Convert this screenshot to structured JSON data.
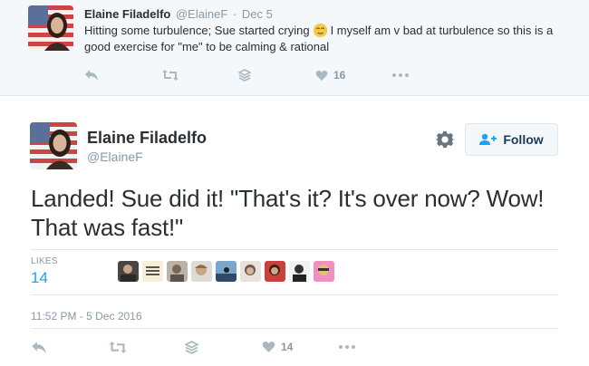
{
  "parent_tweet": {
    "name": "Elaine Filadelfo",
    "handle": "@ElaineF",
    "separator": "·",
    "date": "Dec 5",
    "text_before_emoji": "Hitting some turbulence; Sue started crying",
    "text_after_emoji": "I myself am v bad at turbulence so this is a good exercise for \"me\" to be calming & rational",
    "like_count": "16",
    "icons": [
      "reply-icon",
      "retweet-icon",
      "stack-icon",
      "heart-icon",
      "more-icon"
    ]
  },
  "main_tweet": {
    "name": "Elaine Filadelfo",
    "handle": "@ElaineF",
    "follow_label": "Follow",
    "text": "Landed! Sue did it! \"That's it? It's over now? Wow! That was fast!\"",
    "likes_label": "LIKES",
    "likes_count": "14",
    "timestamp": "11:52 PM - 5 Dec 2016",
    "like_count": "14",
    "liker_count_shown": 9,
    "icons": [
      "reply-icon",
      "retweet-icon",
      "stack-icon",
      "heart-icon",
      "more-icon"
    ]
  },
  "colors": {
    "accent": "#1da1f2",
    "action_icon": "#aab8c2",
    "muted_text": "#8899a6",
    "parent_bg": "#f5f8fa"
  }
}
